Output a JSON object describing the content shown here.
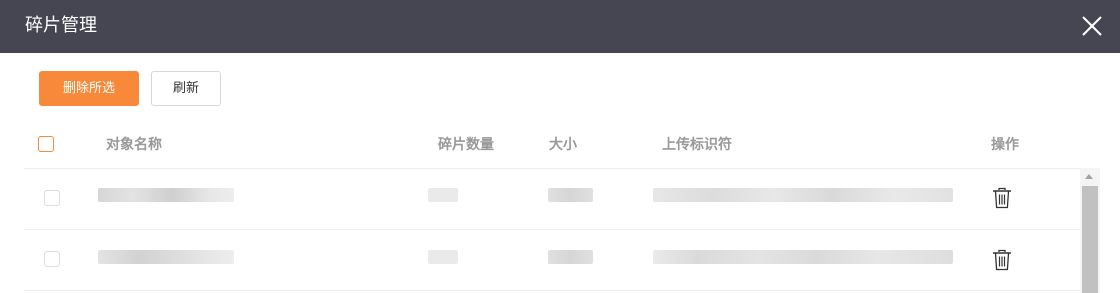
{
  "dialog": {
    "title": "碎片管理",
    "close_icon": "close-icon"
  },
  "toolbar": {
    "delete_selected_label": "删除所选",
    "refresh_label": "刷新"
  },
  "table": {
    "columns": {
      "object_name": "对象名称",
      "chunk_count": "碎片数量",
      "size": "大小",
      "upload_id": "上传标识符",
      "actions": "操作"
    },
    "rows": [
      {
        "action_icon": "trash-icon",
        "values_redacted": true
      },
      {
        "action_icon": "trash-icon",
        "values_redacted": true
      }
    ]
  },
  "colors": {
    "titlebar": "#454651",
    "accent": "#f8893a"
  }
}
